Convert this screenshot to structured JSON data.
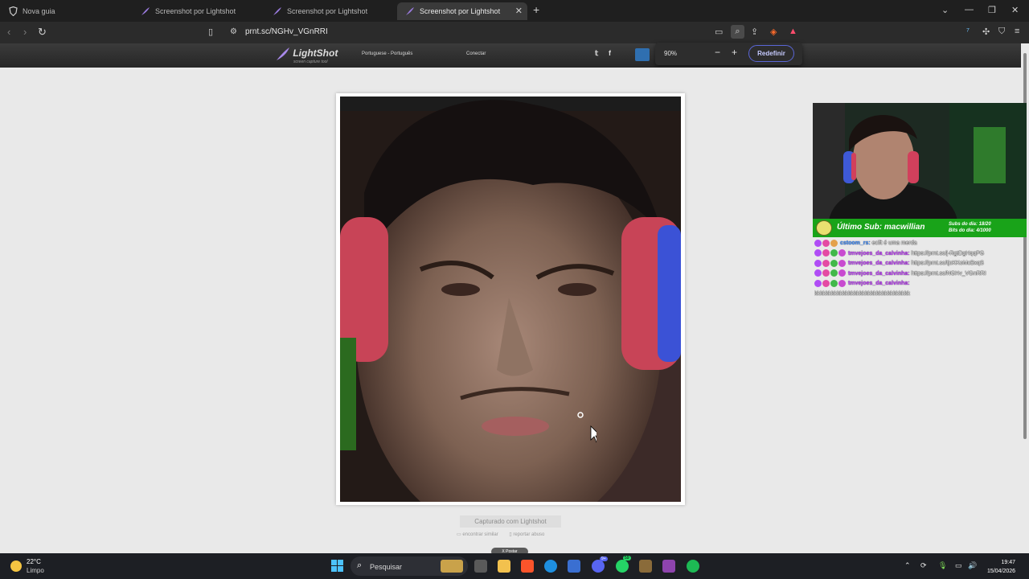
{
  "browser": {
    "tabs": [
      {
        "title": "Nova guia",
        "active": false
      },
      {
        "title": "Screenshot por Lightshot",
        "active": false
      },
      {
        "title": "Screenshot por Lightshot",
        "active": false
      },
      {
        "title": "Screenshot por Lightshot",
        "active": true
      }
    ],
    "url": "prnt.sc/NGHv_VGnRRI",
    "zoom": {
      "level": "90%",
      "minus": "−",
      "plus": "+",
      "reset_label": "Redefinir"
    }
  },
  "lightshot": {
    "logo": "LightShot",
    "logo_sub": "screen capture tool",
    "language": "Portuguese - Português",
    "connect": "Conectar",
    "social": {
      "twitter": "t",
      "facebook": "f"
    },
    "caption": "Capturado com Lightshot",
    "find_similar": "encontrar similar",
    "report_abuse": "reportar abuso",
    "poster": "X Postar"
  },
  "overlay": {
    "last_sub": "Último Sub: macwillian",
    "subs_day": "Subs do dia: 18/20",
    "bits_day": "Bits do dia: 4/1000",
    "chat": [
      {
        "user": "cstoom_rs:",
        "msg": "ecift é uma merda",
        "color": "blue"
      },
      {
        "user": "tmvejoes_da_calvinha:",
        "msg": "https://prnt.sc/j-RgtDgHqqPG",
        "color": "purple"
      },
      {
        "user": "tmvejoes_da_calvinha:",
        "msg": "https://prnt.sc/tjcKKoMcBxqS",
        "color": "purple"
      },
      {
        "user": "tmvejoes_da_calvinha:",
        "msg": "https://prnt.sc/NGHv_VGnRRI",
        "color": "purple"
      },
      {
        "user": "tmvejoes_da_calvinha:",
        "msg": "",
        "color": "purple"
      }
    ],
    "chat_tail": "kkkkkkkkkkkkkkkkkkkkkkkkkkkkkkkkkk"
  },
  "taskbar": {
    "temp": "22°C",
    "sky": "Limpo",
    "search_placeholder": "Pesquisar",
    "time": "19:47",
    "date": "15/04/2026",
    "badges": {
      "discord": "9+",
      "whatsapp": "59"
    }
  }
}
